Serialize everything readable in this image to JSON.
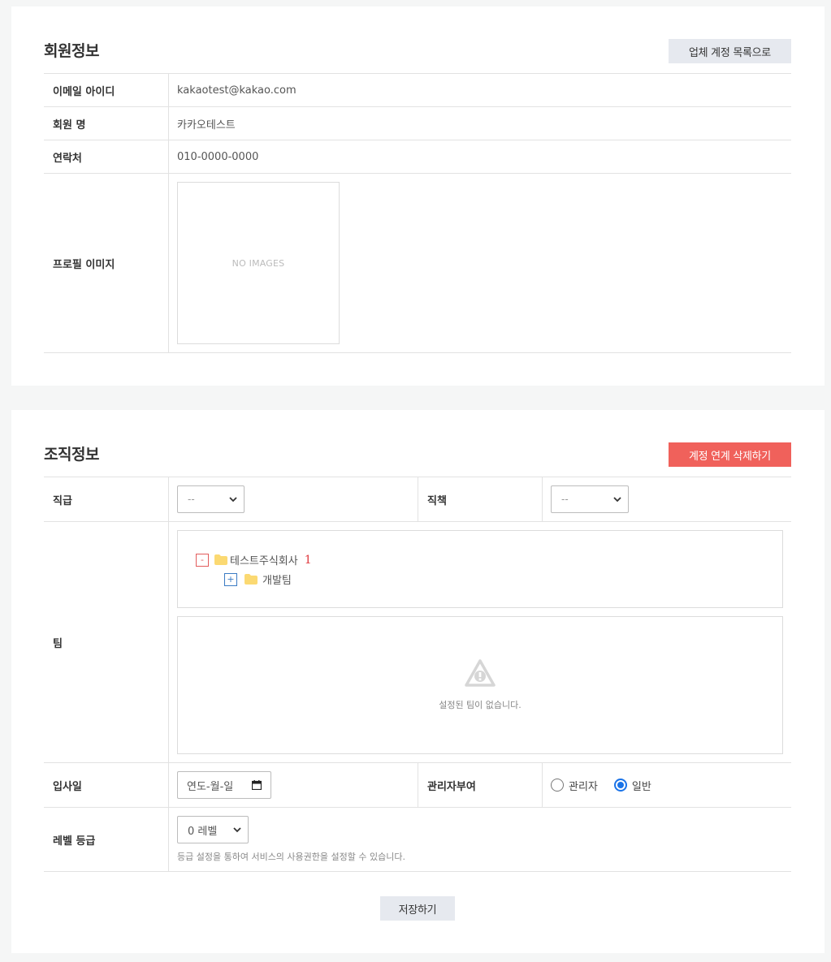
{
  "member": {
    "title": "회원정보",
    "back_button": "업체 계정 목록으로",
    "rows": {
      "email": {
        "label": "이메일 아이디",
        "value": "kakaotest@kakao.com"
      },
      "name": {
        "label": "회원 명",
        "value": "카카오테스트"
      },
      "phone": {
        "label": "연락처",
        "value": "010-0000-0000"
      },
      "profile": {
        "label": "프로필 이미지",
        "placeholder": "NO IMAGES"
      }
    }
  },
  "org": {
    "title": "조직정보",
    "delete_button": "계정 연계 삭제하기",
    "rank": {
      "label": "직급",
      "selected": "--"
    },
    "position": {
      "label": "직책",
      "selected": "--"
    },
    "team": {
      "label": "팀",
      "tree": {
        "root": {
          "toggle": "-",
          "name": "테스트주식회사",
          "count": "1"
        },
        "child": {
          "toggle": "+",
          "name": "개발팀"
        }
      },
      "empty_message": "설정된 팀이 없습니다."
    },
    "join_date": {
      "label": "입사일",
      "placeholder": "연도-월-일"
    },
    "admin": {
      "label": "관리자부여",
      "options": [
        {
          "label": "관리자",
          "checked": false
        },
        {
          "label": "일반",
          "checked": true
        }
      ]
    },
    "level": {
      "label": "레벨 등급",
      "selected": "0 레벨",
      "hint": "등급 설정을 통하여 서비스의 사용권한을 설정할 수 있습니다."
    },
    "save_button": "저장하기"
  },
  "colors": {
    "accent_red": "#f0615b",
    "button_gray": "#e6e9ef",
    "radio_blue": "#1a73e8",
    "folder_yellow": "#fbd972"
  }
}
